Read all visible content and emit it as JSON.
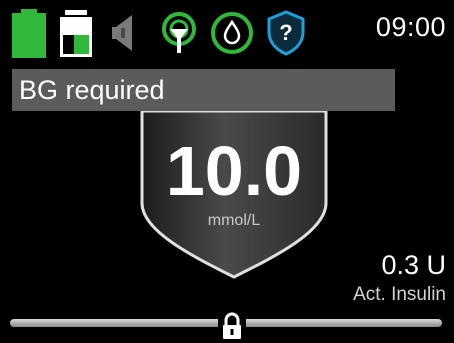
{
  "status_bar": {
    "time": "09:00",
    "icons": [
      {
        "name": "battery-icon",
        "color": "#2fb83a"
      },
      {
        "name": "reservoir-icon",
        "color": "#2fb83a"
      },
      {
        "name": "speaker-icon",
        "color": "#7a7a7a"
      },
      {
        "name": "sensor-signal-icon",
        "color": "#2fb83a"
      },
      {
        "name": "drop-icon",
        "color": "#2fb83a"
      },
      {
        "name": "help-shield-icon",
        "color": "#1e9fd8"
      }
    ]
  },
  "alert": {
    "text": "BG required"
  },
  "glucose": {
    "value": "10.0",
    "unit": "mmol/L"
  },
  "active_insulin": {
    "value": "0.3 U",
    "label": "Act. Insulin"
  },
  "colors": {
    "accent_green": "#2fb83a",
    "help_blue": "#1e9fd8",
    "banner_gray": "#5b5b5b",
    "background": "#000000"
  },
  "lock_bar": {
    "icon": "padlock-icon"
  }
}
